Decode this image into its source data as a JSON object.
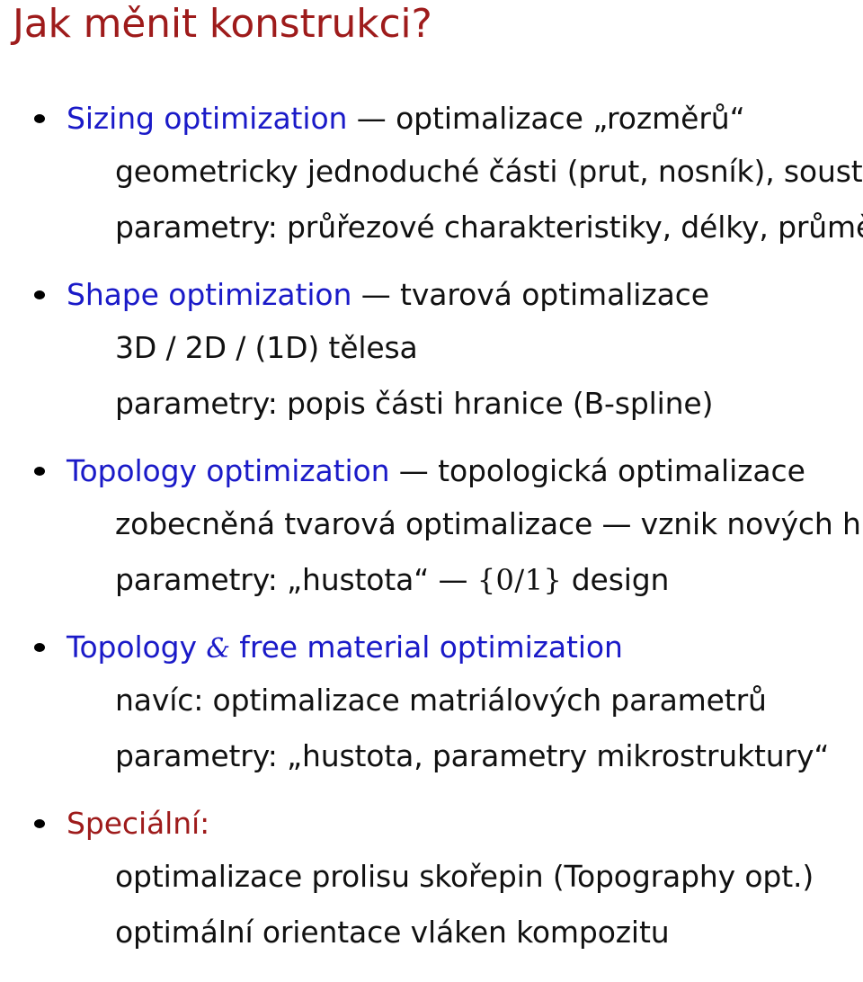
{
  "slide": {
    "title": "Jak měnit konstrukci?",
    "title_color": "#9e1b1b",
    "accent_color": "#1a1ac8",
    "body_color": "#111111",
    "background": "#ffffff"
  },
  "bullets": [
    {
      "label": "Sizing optimization",
      "label_color": "#1a1ac8",
      "dash": " — ",
      "tail": "optimalizace „rozměrů“",
      "sub_lines": [
        "geometricky jednoduché části (prut, nosník), soustavy",
        "parametry: průřezové charakteristiky, délky, průměry,"
      ],
      "sub_trailing_dots": ". . ."
    },
    {
      "label": "Shape optimization",
      "label_color": "#1a1ac8",
      "dash": " — ",
      "tail": "tvarová optimalizace",
      "sub_lines": [
        "3D / 2D / (1D) tělesa",
        "parametry: popis části hranice (B-spline)"
      ]
    },
    {
      "label": "Topology optimization",
      "label_color": "#1a1ac8",
      "dash": " — ",
      "tail": "topologická optimalizace",
      "sub_lines": [
        "zobecněná tvarová optimalizace — vznik nových hranic"
      ],
      "math_line": {
        "prefix": "parametry: „hustota“ — ",
        "math": "{0/1}",
        "suffix": " design"
      }
    },
    {
      "label_pre": "Topology ",
      "ampersand": "&",
      "label_post": " free material optimization",
      "label_color": "#1a1ac8",
      "sub_lines": [
        "navíc: optimalizace matriálových parametrů",
        "parametry: „hustota, parametry mikrostruktury“"
      ]
    },
    {
      "label": "Speciální:",
      "label_color": "#9e1b1b",
      "sub_lines": [
        "optimalizace prolisu skořepin (Topography opt.)",
        "optimální orientace vláken kompozitu"
      ]
    }
  ]
}
